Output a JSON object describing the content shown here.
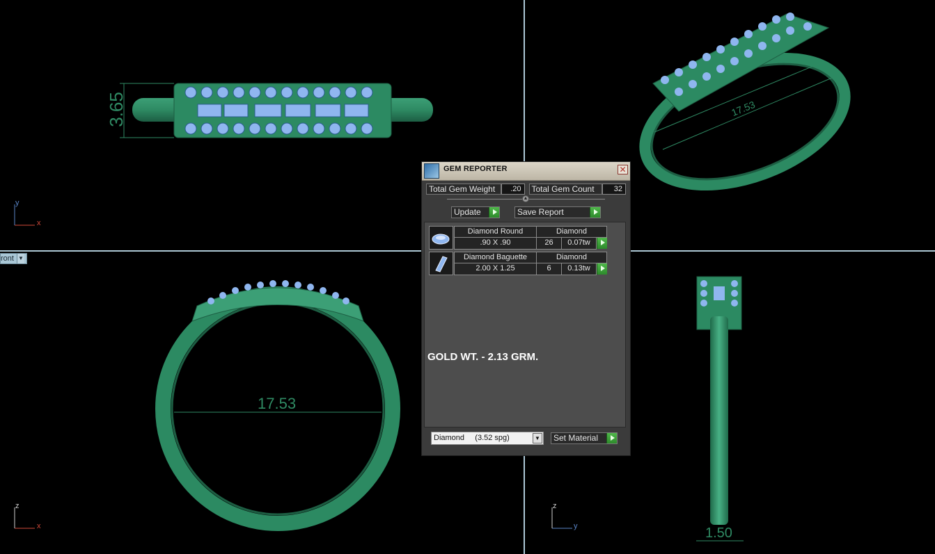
{
  "viewport": {
    "view_label": "ront",
    "dimensions": {
      "top_left": "3.65",
      "top_right": "17.53",
      "bottom_left": "17.53",
      "bottom_right": "1.50"
    },
    "axes": {
      "top_left": {
        "h": "x",
        "v": "y"
      },
      "bottom_left": {
        "h": "x",
        "v": "z"
      },
      "bottom_right": {
        "h": "y",
        "v": "z"
      }
    }
  },
  "gem_reporter": {
    "title": "GEM REPORTER",
    "close_glyph": "✕",
    "total_weight_label": "Total Gem Weight",
    "total_weight_value": ".20",
    "total_count_label": "Total Gem Count",
    "total_count_value": "32",
    "update_label": "Update",
    "save_report_label": "Save Report",
    "gems": [
      {
        "icon": "round-gem-icon",
        "name": "Diamond Round",
        "material": "Diamond",
        "size": ".90 X .90",
        "count": "26",
        "weight": "0.07tw"
      },
      {
        "icon": "baguette-gem-icon",
        "name": "Diamond Baguette",
        "material": "Diamond",
        "size": "2.00 X 1.25",
        "count": "6",
        "weight": "0.13tw"
      }
    ],
    "gold_weight_note": "GOLD WT. - 2.13 GRM.",
    "material_select_value": "Diamond     (3.52 spg)",
    "set_material_label": "Set Material"
  },
  "colors": {
    "ring_green": "#2f8a63",
    "gem_blue": "#8fb6ef",
    "panel_bg": "#3b3b3b",
    "go_green": "#3fa63b",
    "viewport_divider": "#aec8d6"
  }
}
